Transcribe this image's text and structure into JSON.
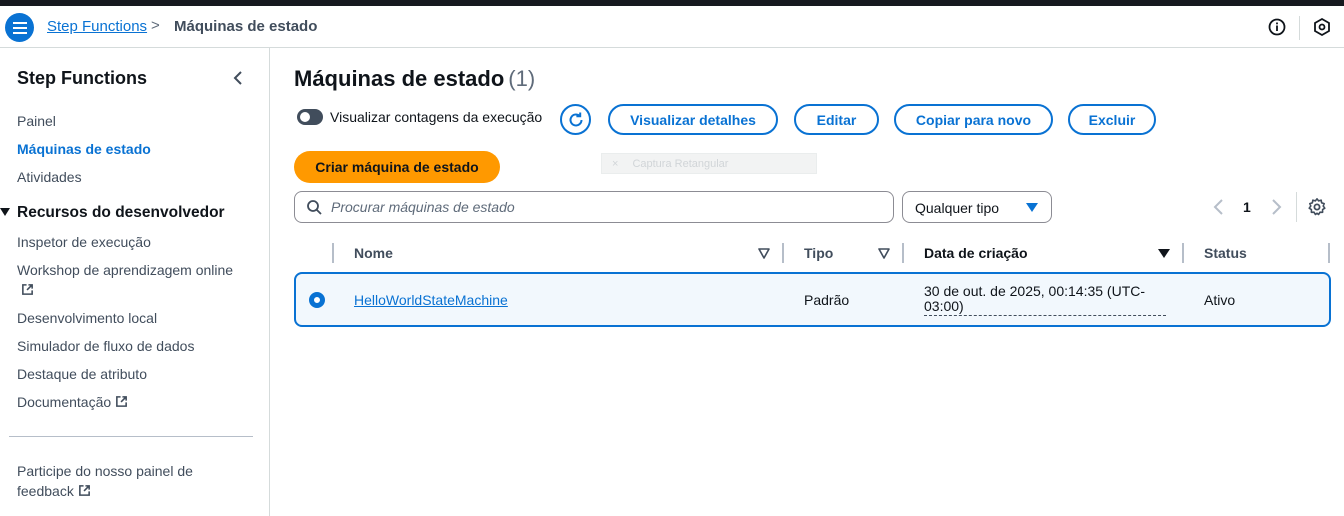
{
  "breadcrumb": {
    "root": "Step Functions",
    "separator": ">",
    "current": "Máquinas de estado"
  },
  "header_icons": [
    "menu-icon",
    "info-icon",
    "notifications-hex-icon"
  ],
  "sidebar": {
    "title": "Step Functions",
    "items": [
      {
        "label": "Painel",
        "active": false
      },
      {
        "label": "Máquinas de estado",
        "active": true
      },
      {
        "label": "Atividades",
        "active": false
      }
    ],
    "section": {
      "label": "Recursos do desenvolvedor",
      "items": [
        {
          "label": "Inspetor de execução"
        },
        {
          "label": "Workshop de aprendizagem online",
          "external": true
        },
        {
          "label": "Desenvolvimento local"
        },
        {
          "label": "Simulador de fluxo de dados"
        },
        {
          "label": "Destaque de atributo"
        },
        {
          "label": "Documentação",
          "external": true
        }
      ]
    },
    "feedback": {
      "line1": "Participe do nosso painel de",
      "line2": "feedback",
      "external": true
    }
  },
  "main": {
    "title": "Máquinas de estado",
    "count": "(1)",
    "toggle_label": "Visualizar contagens da execução",
    "toggle_on": false,
    "buttons": {
      "view_details": "Visualizar detalhes",
      "edit": "Editar",
      "copy_to_new": "Copiar para novo",
      "delete": "Excluir",
      "create": "Criar máquina de estado"
    },
    "overlay_text": "Captura Retangular",
    "search_placeholder": "Procurar máquinas de estado",
    "type_filter": "Qualquer tipo",
    "page": "1",
    "columns": {
      "name": "Nome",
      "type": "Tipo",
      "created": "Data de criação",
      "status": "Status"
    },
    "rows": [
      {
        "name": "HelloWorldStateMachine",
        "type": "Padrão",
        "created_line1": "30 de out. de 2025, 00:14:35 (UTC-",
        "created_line2": "03:00)",
        "status": "Ativo",
        "selected": true
      }
    ]
  },
  "colors": {
    "link": "#0972d3",
    "primary_button": "#ff9900",
    "selected_row_bg": "#f2f8fd",
    "text": "#0f141a"
  }
}
